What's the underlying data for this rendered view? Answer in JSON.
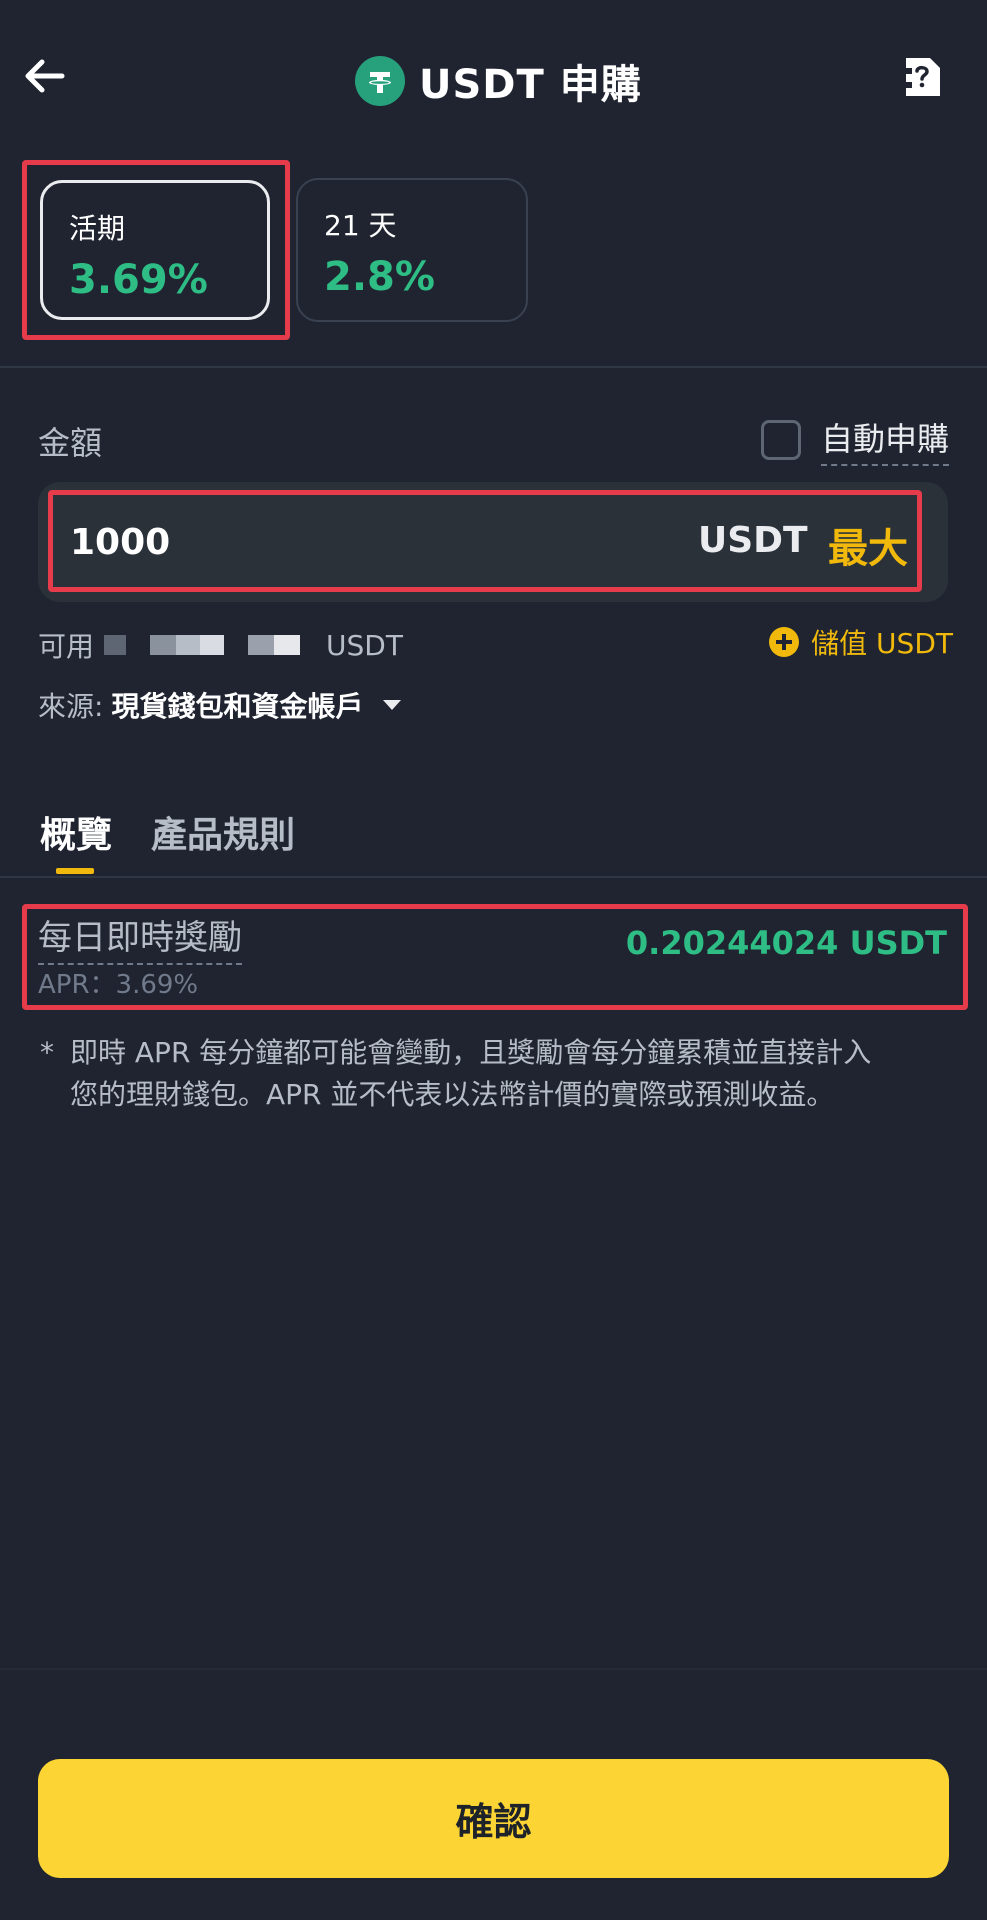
{
  "header": {
    "title": "USDT 申購",
    "token_icon": "tether-icon",
    "back_icon": "arrow-left-icon",
    "help_icon": "help-document-icon"
  },
  "terms": [
    {
      "label": "活期",
      "rate": "3.69%",
      "selected": true
    },
    {
      "label": "21 天",
      "rate": "2.8%",
      "selected": false
    }
  ],
  "amount": {
    "label": "金額",
    "auto_subscribe_label": "自動申購",
    "auto_subscribe_checked": false,
    "value": "1000",
    "unit": "USDT",
    "max_label": "最大"
  },
  "available": {
    "label": "可用",
    "unit": "USDT"
  },
  "deposit": {
    "label": "儲值 USDT"
  },
  "source": {
    "label": "來源:",
    "value": "現貨錢包和資金帳戶"
  },
  "tabs": [
    {
      "label": "概覽",
      "active": true
    },
    {
      "label": "產品規則",
      "active": false
    }
  ],
  "reward": {
    "label": "每日即時獎勵",
    "apr": "APR：3.69%",
    "value": "0.20244024 USDT"
  },
  "note": {
    "star": "*",
    "text": "即時 APR 每分鐘都可能會變動，且獎勵會每分鐘累積並直接計入您的理財錢包。APR 並不代表以法幣計價的實際或預測收益。"
  },
  "confirm_label": "確認",
  "colors": {
    "background": "#1f2430",
    "accent_yellow": "#fcd535",
    "positive_green": "#2ebd85",
    "annotation_red": "#e63b4a"
  }
}
